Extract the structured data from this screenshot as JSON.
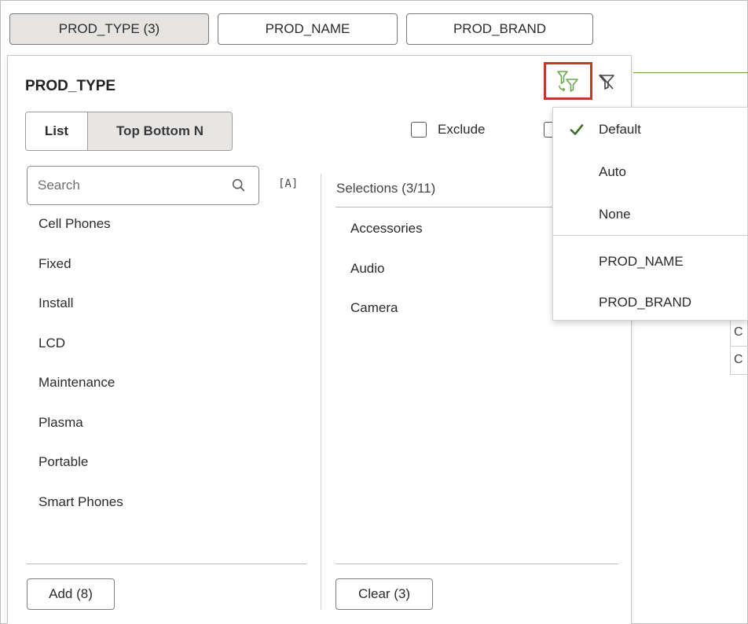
{
  "tabs": [
    {
      "label": "PROD_TYPE (3)"
    },
    {
      "label": "PROD_NAME"
    },
    {
      "label": "PROD_BRAND"
    }
  ],
  "panel": {
    "title": "PROD_TYPE",
    "mode_list": "List",
    "mode_topn": "Top Bottom N",
    "exclude_label": "Exclude",
    "search": {
      "placeholder": "Search",
      "value": ""
    },
    "case_toggle": "[A]",
    "available": [
      "Cell Phones",
      "Fixed",
      "Install",
      "LCD",
      "Maintenance",
      "Plasma",
      "Portable",
      "Smart Phones"
    ],
    "selections_header": "Selections (3/11)",
    "selections": [
      "Accessories",
      "Audio",
      "Camera"
    ],
    "add_label": "Add (8)",
    "clear_label": "Clear (3)"
  },
  "limit_menu": {
    "items": [
      "Default",
      "Auto",
      "None"
    ],
    "columns": [
      "PROD_NAME",
      "PROD_BRAND"
    ],
    "checked": "Default"
  },
  "background": {
    "cells": [
      "C",
      "C"
    ]
  },
  "colors": {
    "accent_green": "#6aa84f",
    "highlight_red": "#c0392b",
    "chip_active": "#e5e4e2"
  },
  "icons": [
    "search-icon",
    "case-sensitive-icon",
    "limit-values-icon",
    "clear-filter-icon",
    "checkmark-icon"
  ]
}
